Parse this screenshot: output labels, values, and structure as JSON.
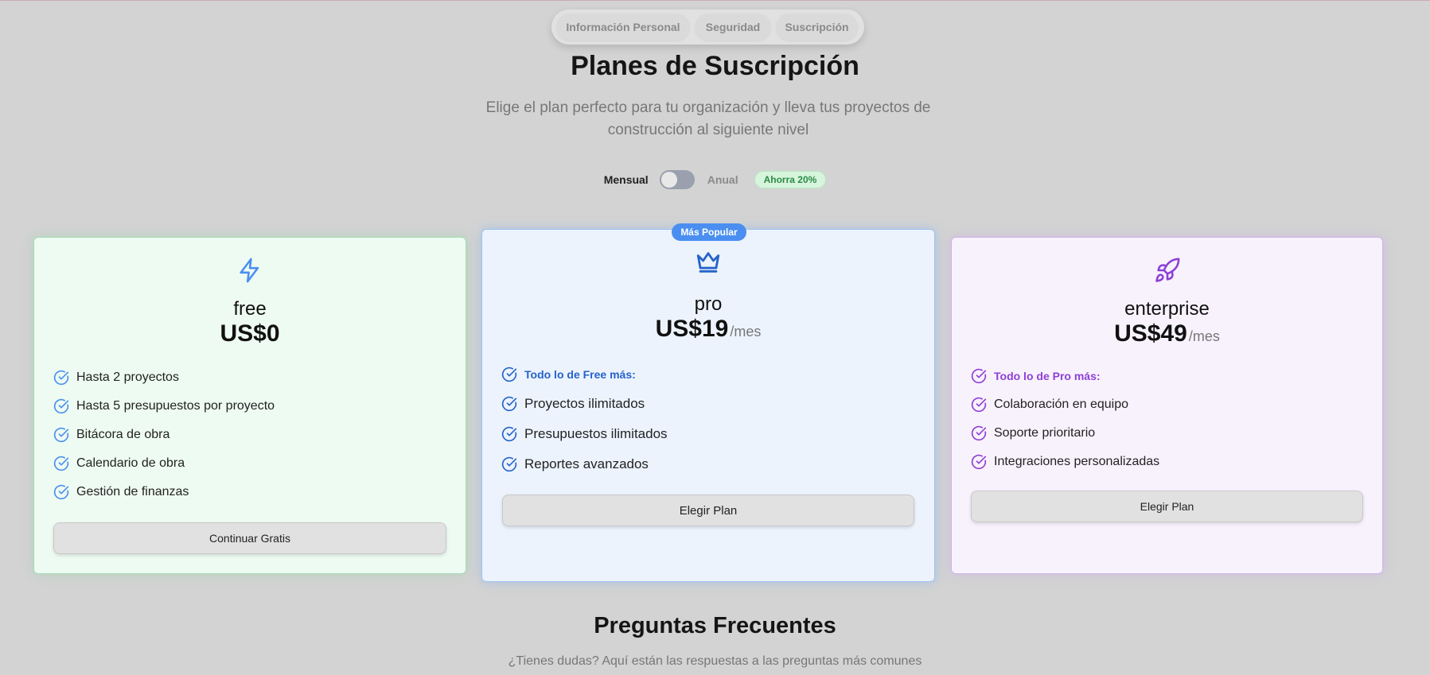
{
  "tabs": [
    {
      "label": "Información Personal"
    },
    {
      "label": "Seguridad"
    },
    {
      "label": "Suscripción"
    }
  ],
  "header": {
    "title": "Planes de Suscripción",
    "subtitle": "Elige el plan perfecto para tu organización y lleva tus proyectos de construcción al siguiente nivel"
  },
  "billing": {
    "monthly_label": "Mensual",
    "annual_label": "Anual",
    "save_badge": "Ahorra 20%",
    "annual_selected": false
  },
  "plans": [
    {
      "name": "free",
      "price": "US$0",
      "period": "",
      "icon": "lightning-icon",
      "accent": "#4a8ff0",
      "features": [
        "Hasta 2 proyectos",
        "Hasta 5 presupuestos por proyecto",
        "Bitácora de obra",
        "Calendario de obra",
        "Gestión de finanzas"
      ],
      "cta": "Continuar Gratis"
    },
    {
      "name": "pro",
      "badge": "Más Popular",
      "price": "US$19",
      "period": "/mes",
      "icon": "crown-icon",
      "accent": "#2563c9",
      "highlight": "Todo lo de Free más:",
      "features": [
        "Proyectos ilimitados",
        "Presupuestos ilimitados",
        "Reportes avanzados"
      ],
      "cta": "Elegir Plan"
    },
    {
      "name": "enterprise",
      "price": "US$49",
      "period": "/mes",
      "icon": "rocket-icon",
      "accent": "#8e3fd6",
      "highlight": "Todo lo de Pro más:",
      "features": [
        "Colaboración en equipo",
        "Soporte prioritario",
        "Integraciones personalizadas"
      ],
      "cta": "Elegir Plan"
    }
  ],
  "faq": {
    "title": "Preguntas Frecuentes",
    "subtitle": "¿Tienes dudas? Aquí están las respuestas a las preguntas más comunes"
  }
}
